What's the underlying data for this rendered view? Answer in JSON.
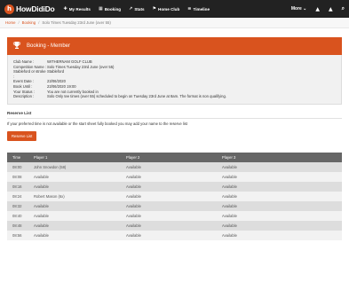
{
  "brand": {
    "logo_glyph": "h",
    "name": "HowDidiDo"
  },
  "nav": {
    "items": [
      {
        "icon": "✚",
        "label": "My Results"
      },
      {
        "icon": "▦",
        "label": "Booking"
      },
      {
        "icon": "↗",
        "label": "Stats"
      },
      {
        "icon": "⚑",
        "label": "Home Club"
      },
      {
        "icon": "≡",
        "label": "Timeline"
      }
    ],
    "more_label": "More ⌄",
    "bell_icon": "▲",
    "user_icon": "▲",
    "search_icon": "⌕"
  },
  "breadcrumb": {
    "home": "Home",
    "booking": "Booking",
    "current": "Solo Times Tuesday 23rd June (over 55)"
  },
  "panel": {
    "icon": "☓",
    "title": "Booking - Member"
  },
  "details": [
    {
      "label": "Club Name :",
      "value": "WITHERNAM GOLF CLUB"
    },
    {
      "label": "Competition Name :",
      "value": "Solo Times Tuesday 23rd June (over 55)"
    },
    {
      "label": "Stableford or stroke :",
      "value": "Stableford"
    },
    {
      "label": "Event Date :",
      "value": "23/06/2020"
    },
    {
      "label": "Book Until :",
      "value": "23/06/2020 19:00"
    },
    {
      "label": "Your Status :",
      "value": "You are not currently booked in"
    },
    {
      "label": "Description :",
      "value": "Solo Only tee times (over 55) scheduled to begin on Tuesday 23rd June at 8am. The format is non qualifying."
    }
  ],
  "reserve": {
    "title": "Reserve List",
    "text": "If your preferred time is not available or the start sheet fully booked you may add your name to the reserve list",
    "button_label": "Reserve List"
  },
  "table": {
    "headers": [
      "Time",
      "Player 1",
      "Player 2",
      "Player 3"
    ],
    "rows": [
      [
        "08:00",
        "John Snowdon (58)",
        "Available",
        "Available"
      ],
      [
        "08:08",
        "Available",
        "Available",
        "Available"
      ],
      [
        "08:16",
        "Available",
        "Available",
        "Available"
      ],
      [
        "08:24",
        "Robert Mason (6x)",
        "Available",
        "Available"
      ],
      [
        "08:32",
        "Available",
        "Available",
        "Available"
      ],
      [
        "08:40",
        "Available",
        "Available",
        "Available"
      ],
      [
        "08:48",
        "Available",
        "Available",
        "Available"
      ],
      [
        "08:56",
        "Available",
        "Available",
        "Available"
      ]
    ]
  },
  "colors": {
    "accent": "#d9531e",
    "topbar": "#222222",
    "table_header": "#666666"
  }
}
